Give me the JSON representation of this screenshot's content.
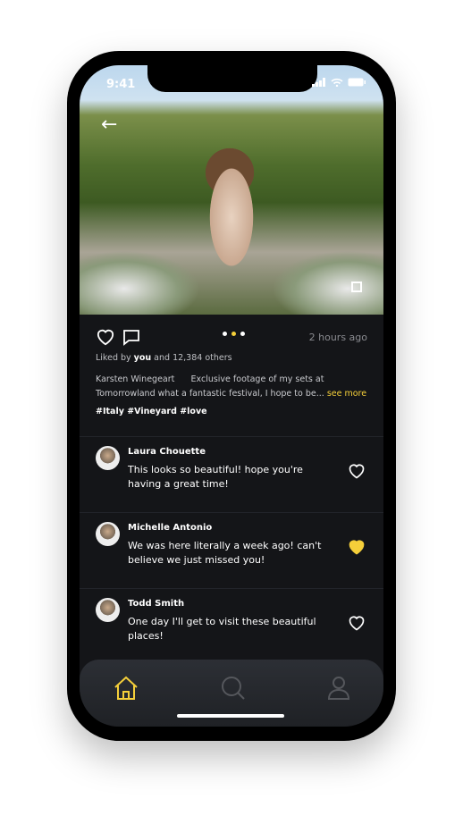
{
  "status": {
    "time": "9:41"
  },
  "post": {
    "liked_prefix": "Liked by ",
    "liked_you": "you",
    "liked_suffix": " and 12,384 others",
    "time": "2 hours ago",
    "author": "Karsten Winegeart",
    "caption": "Exclusive footage of my sets at Tomorrowland what a fantastic festival, I hope to be...",
    "see_more": "see more",
    "tags": "#Italy #Vineyard #love",
    "carousel_active": 2,
    "carousel_total": 3
  },
  "comments": [
    {
      "name": "Laura Chouette",
      "text": "This looks so beautiful! hope you're having a great time!",
      "liked": false
    },
    {
      "name": "Michelle Antonio",
      "text": "We was here literally a week ago! can't believe we just missed you!",
      "liked": true
    },
    {
      "name": "Todd Smith",
      "text": "One day I'll get to visit these beautiful places!",
      "liked": false
    }
  ],
  "colors": {
    "accent": "#f5cf3a",
    "bg": "#141518"
  }
}
